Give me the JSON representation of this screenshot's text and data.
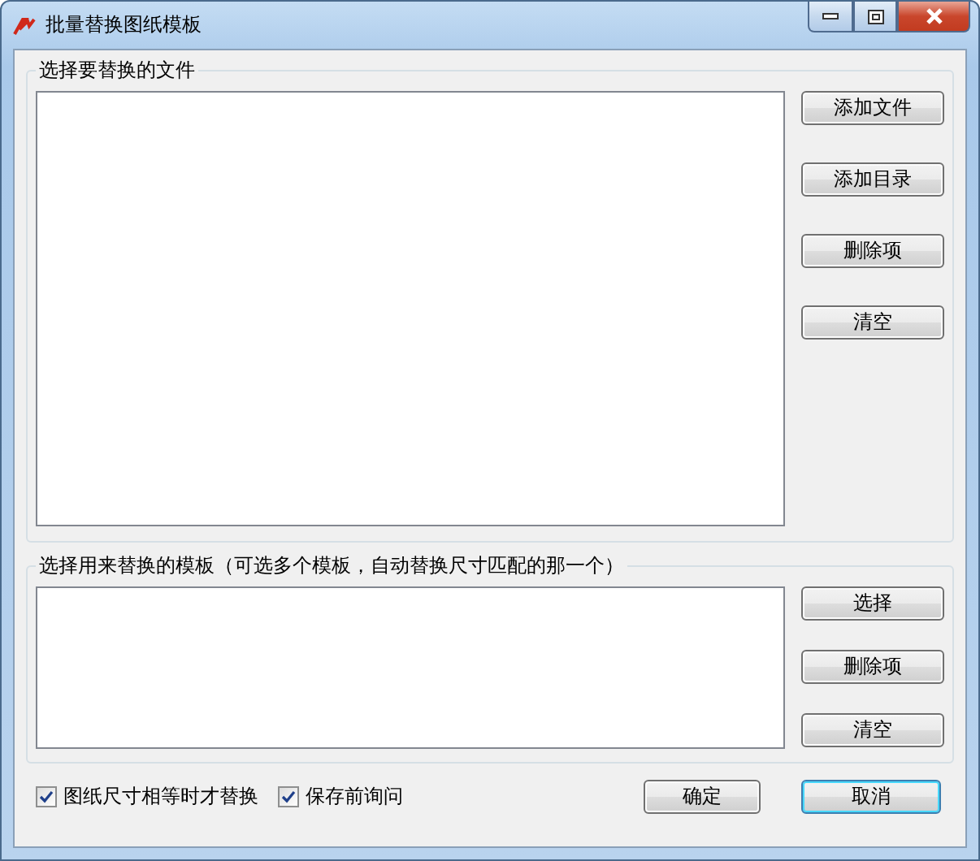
{
  "window": {
    "title": "批量替换图纸模板"
  },
  "files_group": {
    "legend": "选择要替换的文件",
    "buttons": [
      "添加文件",
      "添加目录",
      "删除项",
      "清空"
    ]
  },
  "templates_group": {
    "legend": "选择用来替换的模板（可选多个模板，自动替换尺寸匹配的那一个）",
    "buttons": [
      "选择",
      "删除项",
      "清空"
    ]
  },
  "options": [
    {
      "label": "图纸尺寸相等时才替换",
      "checked": true
    },
    {
      "label": "保存前询问",
      "checked": true
    }
  ],
  "buttons": [
    {
      "label": "确定",
      "focused": false
    },
    {
      "label": "取消",
      "focused": true
    }
  ]
}
